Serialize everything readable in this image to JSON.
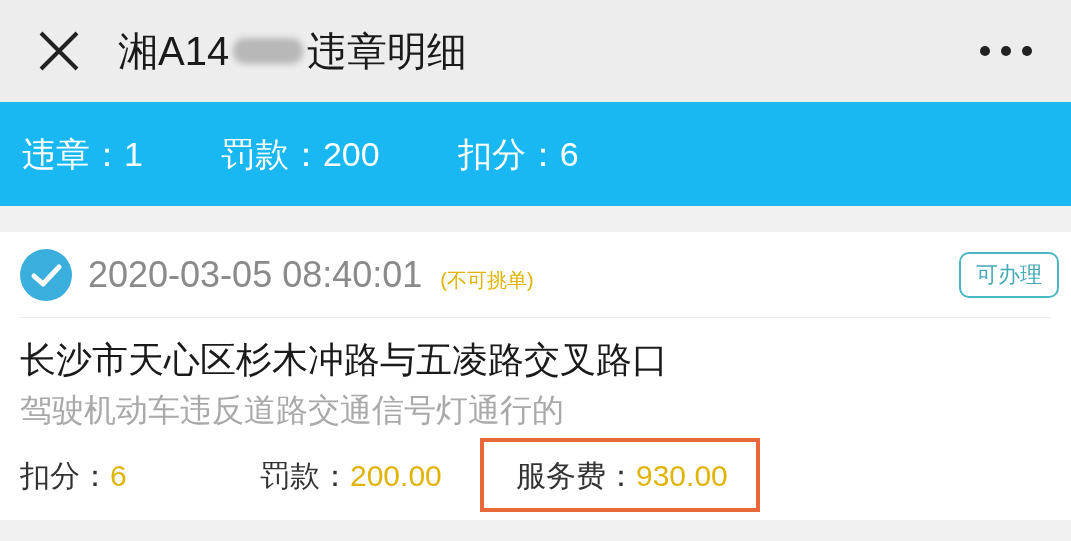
{
  "nav": {
    "title_prefix": "湘A14",
    "redacted": true,
    "title_suffix": "违章明细"
  },
  "summary": [
    "违章：1",
    "罚款：200",
    "扣分：6"
  ],
  "record": {
    "checked": true,
    "datetime": "2020-03-05 08:40:01",
    "note": "(不可挑单)",
    "action": "可办理",
    "location": "长沙市天心区杉木冲路与五凌路交叉路口",
    "violation": "驾驶机动车违反道路交通信号灯通行的",
    "fees": [
      {
        "label": "扣分：",
        "value": "6",
        "highlighted": false
      },
      {
        "label": "罚款：",
        "value": "200.00",
        "highlighted": false
      },
      {
        "label": "服务费：",
        "value": "930.00",
        "highlighted": true
      }
    ]
  }
}
